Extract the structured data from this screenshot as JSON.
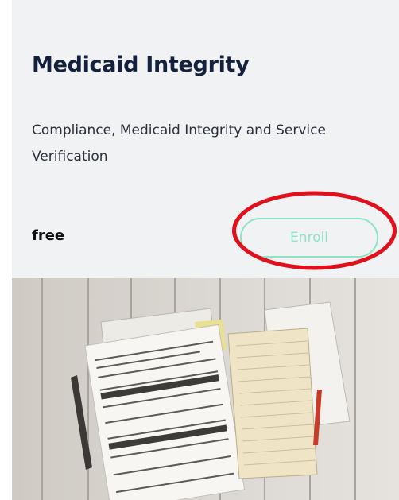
{
  "course": {
    "title": "Medicaid Integrity",
    "description": "Compliance, Medicaid Integrity and Service Verification",
    "price": "free",
    "enroll_label": "Enroll"
  },
  "colors": {
    "card_background": "#f1f2f4",
    "title": "#14213d",
    "button_accent": "#8fe3c5",
    "highlight_ring": "#e0101c"
  }
}
